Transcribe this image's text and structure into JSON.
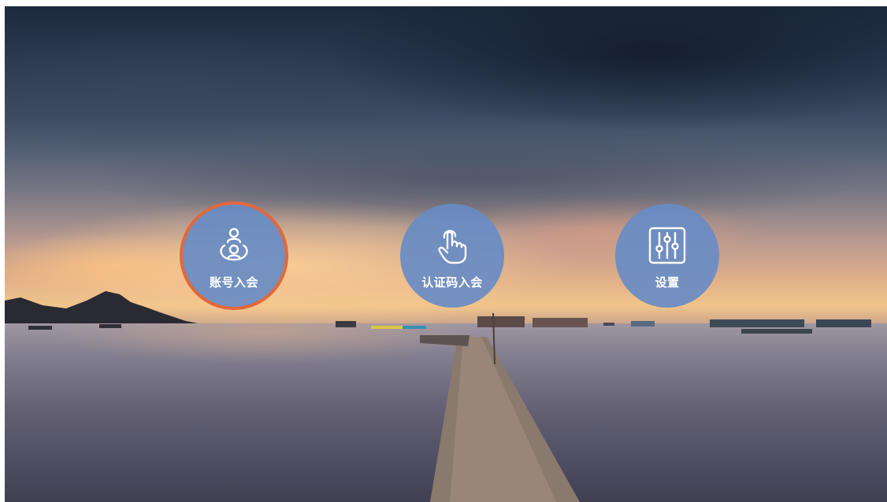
{
  "menu": {
    "items": [
      {
        "id": "account",
        "label": "账号入会",
        "icon": "account-users-icon",
        "focused": true
      },
      {
        "id": "code",
        "label": "认证码入会",
        "icon": "touch-hand-icon",
        "focused": false
      },
      {
        "id": "settings",
        "label": "设置",
        "icon": "sliders-icon",
        "focused": false
      }
    ]
  },
  "colors": {
    "button_fill": "#688cc4",
    "focus_ring": "#e4673a",
    "label_text": "#ffffff"
  }
}
